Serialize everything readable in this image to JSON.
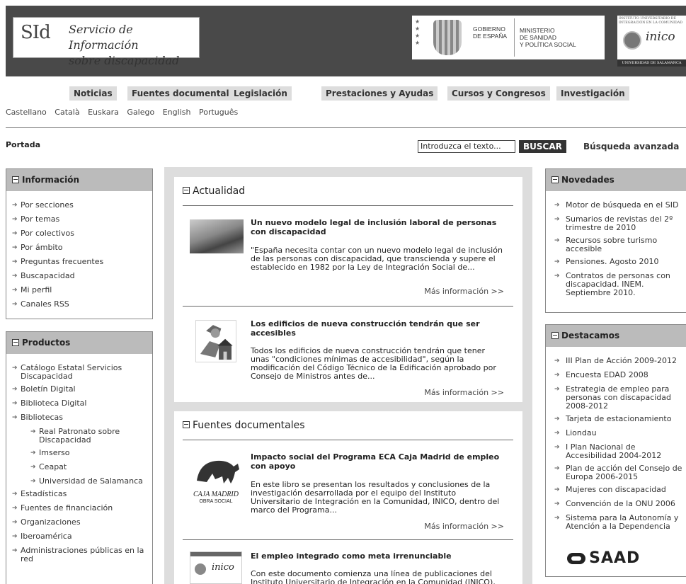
{
  "header": {
    "sid_logo_mark": "SId",
    "sid_logo_line1": "Servicio de Información",
    "sid_logo_line2": "sobre discapacidad",
    "gov_line1": "GOBIERNO",
    "gov_line2": "DE ESPAÑA",
    "ministry_line1": "MINISTERIO",
    "ministry_line2": "DE SANIDAD",
    "ministry_line3": "Y POLÍTICA SOCIAL",
    "inico_top_line1": "INSTITUTO UNIVERSITARIO DE",
    "inico_top_line2": "INTEGRACIÓN EN LA COMUNIDAD",
    "inico_logo": "inico",
    "inico_bottom": "UNIVERSIDAD DE SALAMANCA"
  },
  "nav": {
    "items": [
      "Noticias",
      "Fuentes documentales",
      "Legislación",
      "Prestaciones y Ayudas",
      "Cursos y Congresos",
      "Investigación"
    ]
  },
  "languages": [
    "Castellano",
    "Català",
    "Euskara",
    "Galego",
    "English",
    "Português"
  ],
  "breadcrumb": "Portada",
  "search": {
    "value": "Introduzca el texto...",
    "button": "BUSCAR",
    "advanced": "Búsqueda avanzada"
  },
  "left": {
    "informacion": {
      "title": "Información",
      "items": [
        "Por secciones",
        "Por temas",
        "Por colectivos",
        "Por ámbito",
        "Preguntas frecuentes",
        "Buscapacidad",
        "Mi perfil",
        "Canales RSS"
      ]
    },
    "productos": {
      "title": "Productos",
      "items": [
        "Catálogo Estatal Servicios Discapacidad",
        "Boletín Digital",
        "Biblioteca Digital",
        "Bibliotecas",
        "Real Patronato sobre Discapacidad",
        "Imserso",
        "Ceapat",
        "Universidad de Salamanca",
        "Estadísticas",
        "Fuentes de financiación",
        "Organizaciones",
        "Iberoamérica",
        "Administraciones públicas en la red"
      ]
    }
  },
  "center": {
    "actualidad": {
      "title": "Actualidad",
      "articles": [
        {
          "title": "Un nuevo modelo legal de inclusión laboral de personas con discapacidad",
          "body": "\"España necesita contar con un nuevo modelo legal de inclusión de las personas con discapacidad, que transcienda y supere el establecido en 1982 por la Ley de Integración Social de...",
          "more": "Más información >>"
        },
        {
          "title": "Los edificios de nueva construcción tendrán que ser accesibles",
          "body": "Todos los edificios de nueva construcción tendrán que tener unas \"condiciones mínimas de accesibilidad\", según la modificación del Código Técnico de la Edificación aprobado por Consejo de Ministros antes de...",
          "more": "Más información >>"
        }
      ]
    },
    "fuentes": {
      "title": "Fuentes documentales",
      "articles": [
        {
          "title": "Impacto social del Programa ECA Caja Madrid de empleo con apoyo",
          "body": "En este libro se presentan los resultados y conclusiones de la investigación desarrollada por el equipo del Instituto Universitario de Integración en la Comunidad, INICO, dentro del marco del Programa...",
          "more": "Más información >>",
          "thumb_line1": "CAJA MADRID",
          "thumb_line2": "OBRA SOCIAL"
        },
        {
          "title": "El empleo integrado como meta irrenunciable",
          "body": "Con este documento comienza una línea de publicaciones del Instituto Universitario de Integración en la Comunidad (INICO), denominada...",
          "thumb_logo": "inico"
        }
      ]
    }
  },
  "right": {
    "novedades": {
      "title": "Novedades",
      "items": [
        "Motor de búsqueda en el SID",
        "Sumarios de revistas del 2º trimestre de 2010",
        "Recursos sobre turismo accesible",
        "Pensiones. Agosto 2010",
        "Contratos de personas con discapacidad. INEM. Septiembre 2010."
      ]
    },
    "destacamos": {
      "title": "Destacamos",
      "items": [
        "III Plan de Acción 2009-2012",
        "Encuesta EDAD 2008",
        "Estrategia de empleo para personas con discapacidad 2008-2012",
        "Tarjeta de estacionamiento",
        "Liondau",
        "I Plan Nacional de Accesibilidad 2004-2012",
        "Plan de acción del Consejo de Europa 2006-2015",
        "Mujeres con discapacidad",
        "Convención de la ONU 2006",
        "Sistema para la Autonomía y Atención a la Dependencia"
      ],
      "saad_logo": "SAAD"
    }
  }
}
